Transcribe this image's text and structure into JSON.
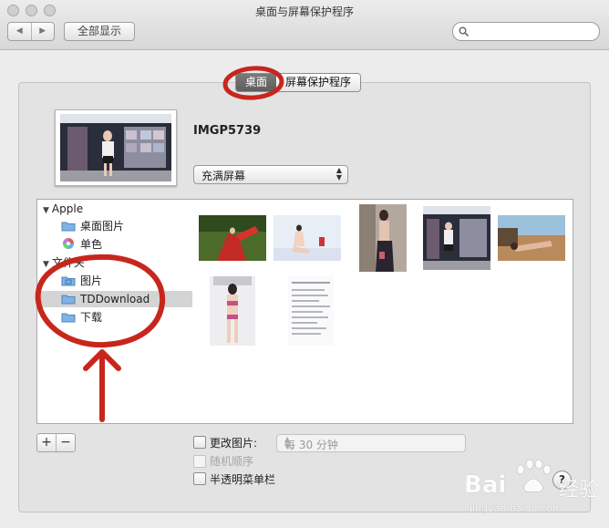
{
  "window": {
    "title": "桌面与屏幕保护程序"
  },
  "toolbar": {
    "back": "◀",
    "forward": "▶",
    "show_all": "全部显示",
    "search_placeholder": ""
  },
  "tabs": [
    {
      "label": "桌面",
      "selected": true
    },
    {
      "label": "屏幕保护程序",
      "selected": false
    }
  ],
  "preview": {
    "image_name": "IMGP5739",
    "fit_option": "充满屏幕"
  },
  "sidebar": {
    "groups": [
      {
        "label": "Apple",
        "items": [
          "桌面图片",
          "单色"
        ]
      },
      {
        "label": "文件夹",
        "items": [
          "图片",
          "TDDownload",
          "下载"
        ]
      }
    ],
    "selected": "TDDownload"
  },
  "thumbnails_count": 7,
  "controls": {
    "add": "+",
    "remove": "−",
    "change_picture": {
      "label": "更改图片:",
      "checked": false
    },
    "interval": "每 30 分钟",
    "random_order": {
      "label": "随机顺序",
      "checked": false,
      "disabled": true
    },
    "translucent_menu": {
      "label": "半透明菜单栏",
      "checked": false
    }
  },
  "help": "?",
  "watermark": {
    "brand": "Bai",
    "suffix": "经验",
    "url": "jingyan.baidu.com"
  },
  "colors": {
    "annotation_red": "#c8261d",
    "selection": "#d4d4d4"
  }
}
